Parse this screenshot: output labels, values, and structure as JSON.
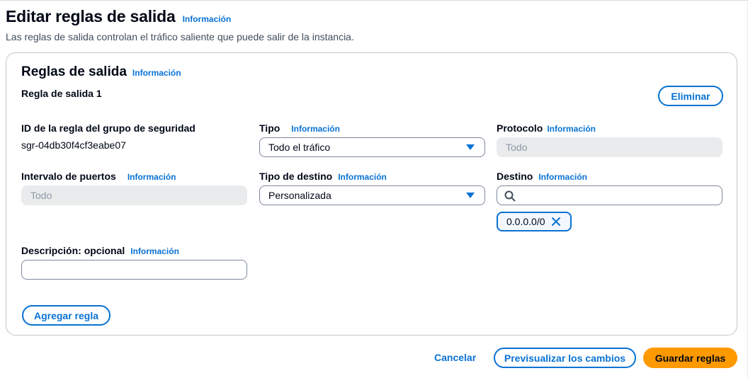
{
  "header": {
    "title": "Editar reglas de salida",
    "info_label": "Información",
    "description": "Las reglas de salida controlan el tráfico saliente que puede salir de la instancia."
  },
  "panel": {
    "title": "Reglas de salida",
    "info_label": "Información",
    "rule_title": "Regla de salida 1",
    "delete_label": "Eliminar",
    "fields": {
      "rule_id": {
        "label": "ID de la regla del grupo de seguridad",
        "value": "sgr-04db30f4cf3eabe07"
      },
      "type": {
        "label": "Tipo",
        "info_label": "Información",
        "value": "Todo el tráfico"
      },
      "protocol": {
        "label": "Protocolo",
        "info_label": "Información",
        "value": "Todo"
      },
      "port_range": {
        "label": "Intervalo de puertos",
        "info_label": "Información",
        "value": "Todo"
      },
      "destination_type": {
        "label": "Tipo de destino",
        "info_label": "Información",
        "value": "Personalizada"
      },
      "destination": {
        "label": "Destino",
        "info_label": "Información",
        "search_value": "",
        "token": "0.0.0.0/0"
      },
      "description": {
        "label": "Descripción: opcional",
        "info_label": "Información",
        "value": ""
      }
    },
    "add_rule_label": "Agregar regla"
  },
  "footer": {
    "cancel_label": "Cancelar",
    "preview_label": "Previsualizar los cambios",
    "save_label": "Guardar reglas"
  },
  "colors": {
    "accent": "#0972d3",
    "primary_button": "#ff9900",
    "disabled_field": "#e9ebed"
  },
  "icons": [
    "search-icon",
    "caret-down-icon",
    "close-icon"
  ]
}
